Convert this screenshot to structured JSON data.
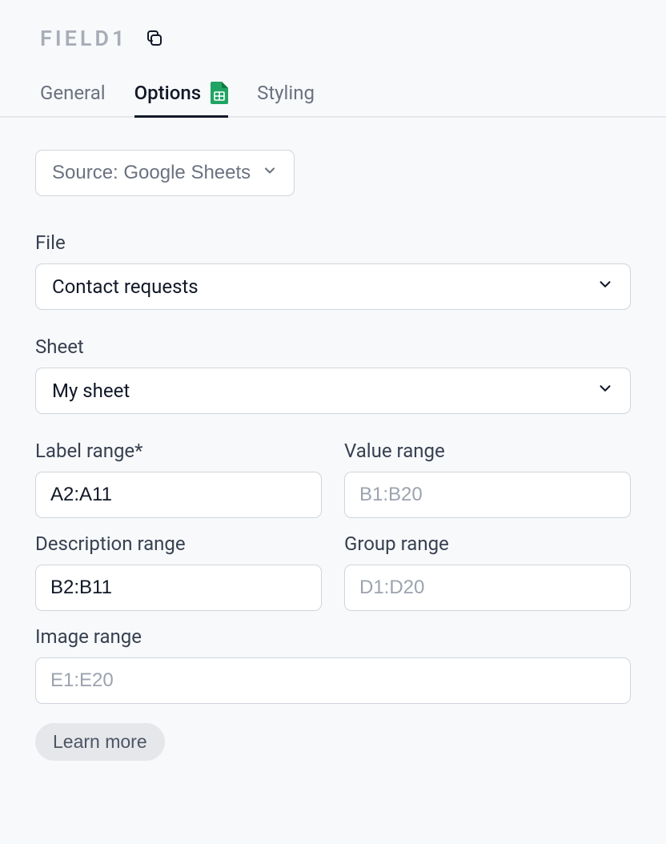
{
  "header": {
    "title": "FIELD1"
  },
  "tabs": {
    "general": "General",
    "options": "Options",
    "styling": "Styling"
  },
  "source": {
    "label": "Source: Google Sheets"
  },
  "file": {
    "label": "File",
    "value": "Contact requests"
  },
  "sheet": {
    "label": "Sheet",
    "value": "My sheet"
  },
  "labelRange": {
    "label": "Label range*",
    "value": "A2:A11"
  },
  "valueRange": {
    "label": "Value range",
    "placeholder": "B1:B20"
  },
  "descRange": {
    "label": "Description range",
    "value": "B2:B11"
  },
  "groupRange": {
    "label": "Group range",
    "placeholder": "D1:D20"
  },
  "imageRange": {
    "label": "Image range",
    "placeholder": "E1:E20"
  },
  "learnMore": "Learn more"
}
